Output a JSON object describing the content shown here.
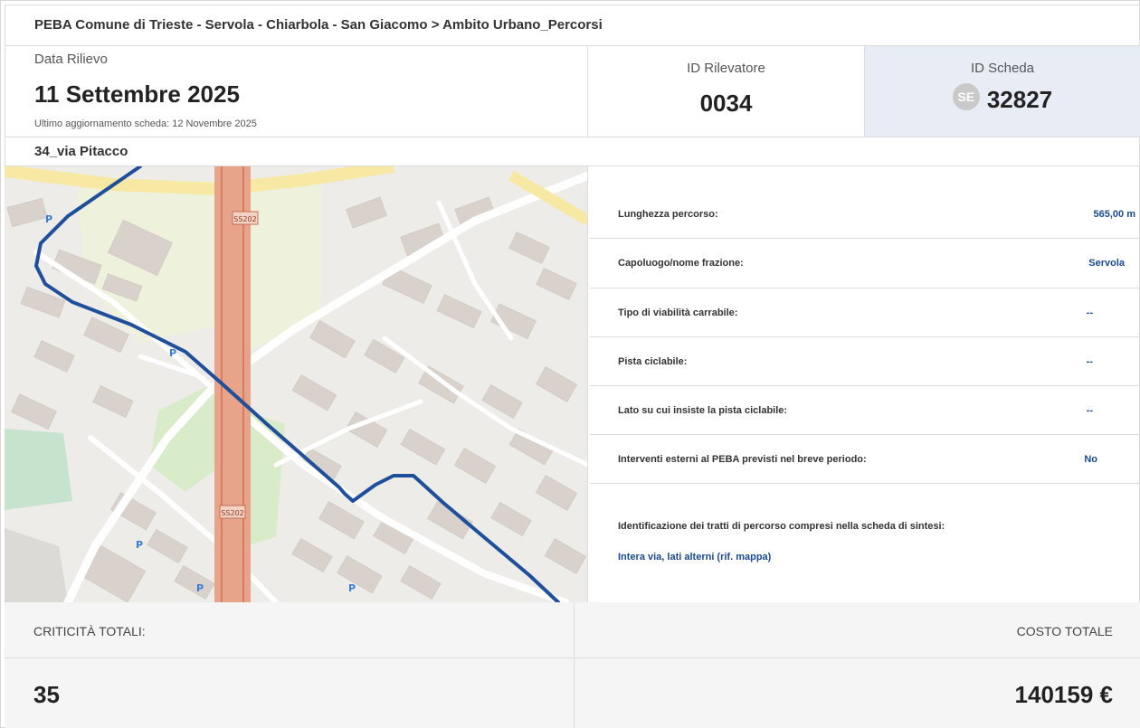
{
  "breadcrumb": "PEBA Comune di Trieste - Servola - Chiarbola - San Giacomo > Ambito Urbano_Percorsi",
  "header": {
    "date_label": "Data Rilievo",
    "date_value": "11 Settembre 2025",
    "last_update": "Ultimo aggiornamento scheda: 12 Novembre 2025",
    "rilevatore_label": "ID Rilevatore",
    "rilevatore_value": "0034",
    "scheda_label": "ID Scheda",
    "scheda_badge": "SE",
    "scheda_value": "32827",
    "scheda_bg": "#e8edf5"
  },
  "street_name": "34_via Pitacco",
  "map": {
    "labels": [
      "SS202",
      "SS202",
      "P",
      "P",
      "P",
      "P",
      "P"
    ],
    "route_color": "#1f4e9a"
  },
  "info": {
    "rows": [
      {
        "label": "Lunghezza percorso:",
        "value": "565,00 m"
      },
      {
        "label": "Capoluogo/nome frazione:",
        "value": "Servola"
      },
      {
        "label": "Tipo di viabilità carrabile:",
        "value": "--"
      },
      {
        "label": "Pista ciclabile:",
        "value": "--"
      },
      {
        "label": "Lato su cui insiste la pista ciclabile:",
        "value": "--"
      },
      {
        "label": "Interventi esterni al PEBA previsti nel breve periodo:",
        "value": "No"
      }
    ],
    "tratti_label": "Identificazione dei tratti di percorso compresi nella scheda di sintesi:",
    "tratti_value": "Intera via, lati alterni (rif. mappa)",
    "value_color": "#1a4a8c"
  },
  "totals": {
    "criticita_label": "CRITICITÀ TOTALI:",
    "criticita_value": "35",
    "costo_label": "COSTO TOTALE",
    "costo_value": "140159 €"
  }
}
